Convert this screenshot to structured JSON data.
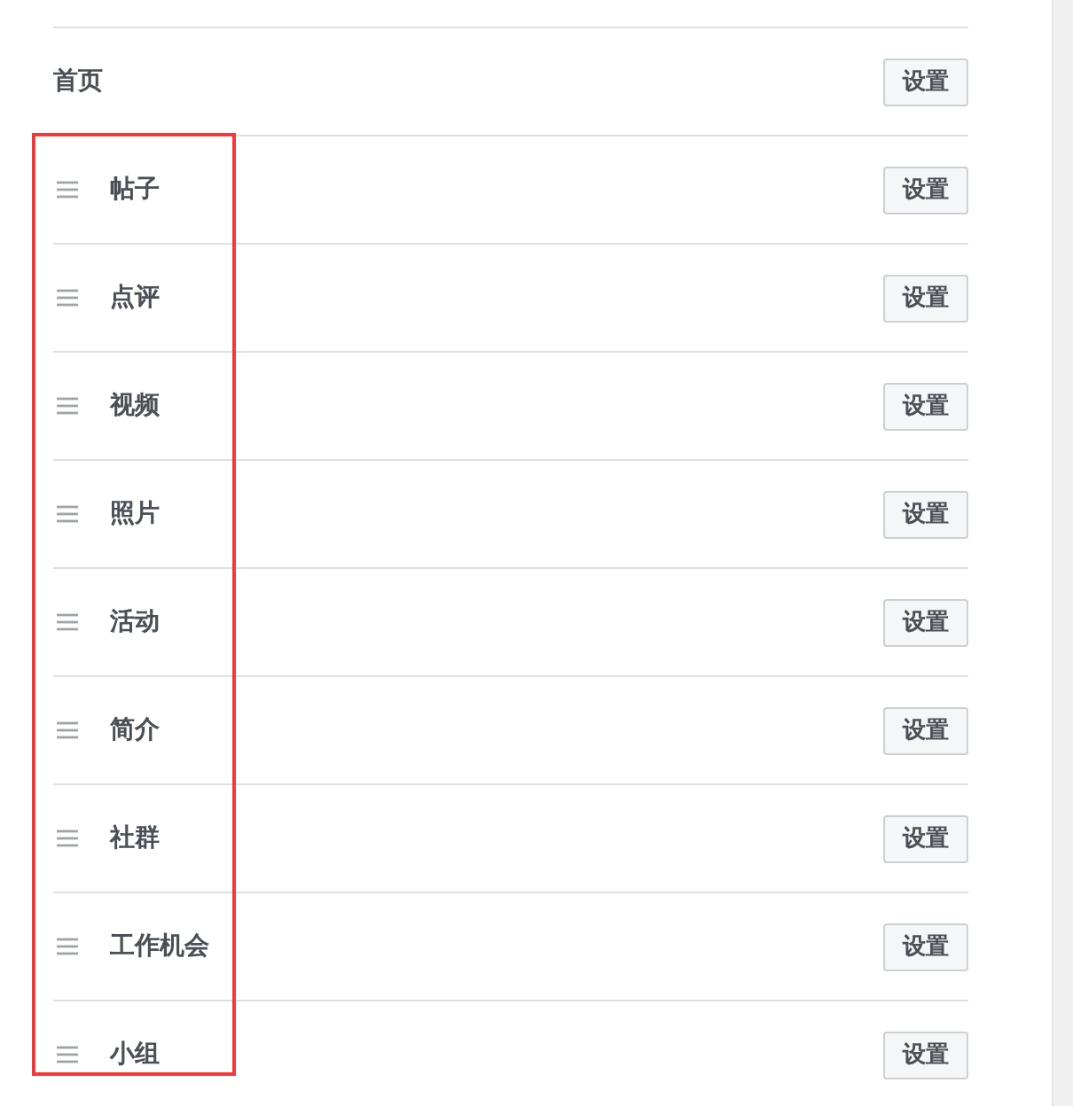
{
  "tabs_list": [
    {
      "kind": "fixed",
      "label": "首页",
      "button": "设置"
    },
    {
      "kind": "draggable",
      "label": "帖子",
      "button": "设置"
    },
    {
      "kind": "draggable",
      "label": "点评",
      "button": "设置"
    },
    {
      "kind": "draggable",
      "label": "视频",
      "button": "设置"
    },
    {
      "kind": "draggable",
      "label": "照片",
      "button": "设置"
    },
    {
      "kind": "draggable",
      "label": "活动",
      "button": "设置"
    },
    {
      "kind": "draggable",
      "label": "简介",
      "button": "设置"
    },
    {
      "kind": "draggable",
      "label": "社群",
      "button": "设置"
    },
    {
      "kind": "draggable",
      "label": "工作机会",
      "button": "设置"
    },
    {
      "kind": "draggable",
      "label": "小组",
      "button": "设置"
    }
  ]
}
